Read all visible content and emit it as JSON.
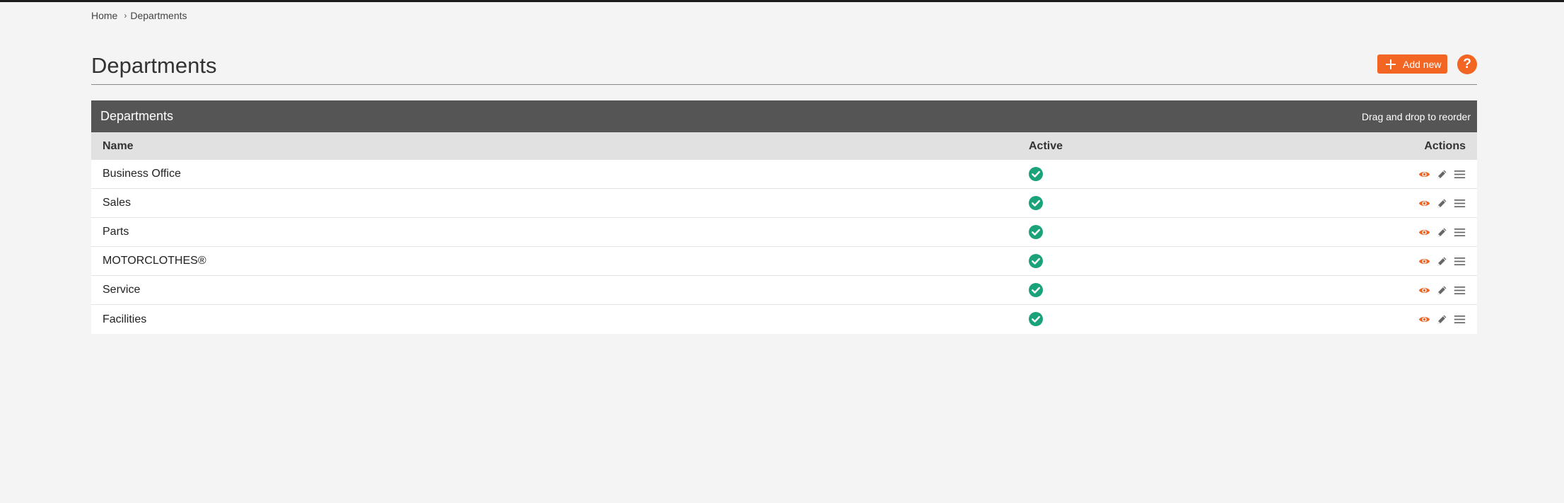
{
  "breadcrumb": {
    "home": "Home",
    "separator": "›",
    "current": "Departments"
  },
  "header": {
    "title": "Departments",
    "add_new_label": "Add new",
    "help_label": "?"
  },
  "panel": {
    "title": "Departments",
    "hint": "Drag and drop to reorder"
  },
  "table": {
    "columns": {
      "name": "Name",
      "active": "Active",
      "actions": "Actions"
    },
    "rows": [
      {
        "name": "Business Office",
        "active": true
      },
      {
        "name": "Sales",
        "active": true
      },
      {
        "name": "Parts",
        "active": true
      },
      {
        "name": "MOTORCLOTHES®",
        "active": true
      },
      {
        "name": "Service",
        "active": true
      },
      {
        "name": "Facilities",
        "active": true
      }
    ]
  },
  "icons": {
    "active": "check-circle-icon",
    "view": "eye-icon",
    "edit": "pencil-icon",
    "reorder": "drag-handle-icon"
  },
  "colors": {
    "accent": "#f26522",
    "active_check": "#1aa37a",
    "panel_header": "#555555",
    "table_head": "#e1e1e1",
    "icon_gray": "#666666"
  }
}
